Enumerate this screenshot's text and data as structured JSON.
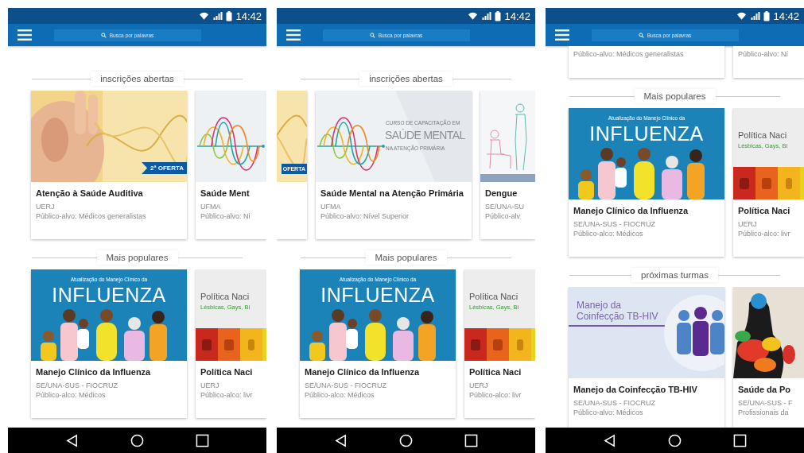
{
  "phones": [
    {
      "status_time": "14:42",
      "search_placeholder": "Busca por palavras",
      "sections": [
        {
          "title": "inscrições abertas",
          "cards": [
            {
              "kind": "full",
              "image": {
                "kind": "ear"
              },
              "badge": "2ª OFERTA",
              "title": "Atenção à Saúde Auditiva",
              "lines": [
                "UERJ",
                "Público-alvo: Médicos generalistas"
              ]
            },
            {
              "kind": "rightcut",
              "image": {
                "kind": "waves"
              },
              "title": "Saúde Ment",
              "lines": [
                "UFMA",
                "Público-alvo: Ni"
              ]
            }
          ]
        },
        {
          "title": "Mais populares",
          "cards": [
            {
              "kind": "full",
              "image": {
                "kind": "influenza",
                "texts": [
                  "Atualização do Manejo Clínico da",
                  "INFLUENZA"
                ]
              },
              "title": "Manejo Clínico da Influenza",
              "lines": [
                "SE/UNA-SUS - FIOCRUZ",
                "Público-alco: Médicos"
              ]
            },
            {
              "kind": "rightcut",
              "image": {
                "kind": "politica",
                "texts": [
                  "Política Naci",
                  "Lésbicas, Gays, Bi"
                ]
              },
              "title": "Política Naci",
              "lines": [
                "UERJ",
                "Público-alco: livr"
              ]
            }
          ]
        }
      ]
    },
    {
      "status_time": "14:42",
      "search_placeholder": "Busca por palavras",
      "sections": [
        {
          "title": "inscrições abertas",
          "cards": [
            {
              "kind": "leftcut",
              "image": {
                "kind": "ear"
              },
              "badge": "OFERTA"
            },
            {
              "kind": "full",
              "image": {
                "kind": "waves",
                "texts": [
                  "CURSO DE CAPACITAÇÃO EM",
                  "SAÚDE MENTAL",
                  "NA ATENÇÃO PRIMÁRIA"
                ]
              },
              "title": "Saúde Mental na Atenção Primária",
              "lines": [
                "UFMA",
                "Público-alvo: Nível Superior"
              ]
            },
            {
              "kind": "rightcut",
              "image": {
                "kind": "dengue"
              },
              "title": "Dengue",
              "lines": [
                "SE/UNA-SU",
                "Público-alv"
              ]
            }
          ]
        },
        {
          "title": "Mais populares",
          "cards": [
            {
              "kind": "full",
              "image": {
                "kind": "influenza",
                "texts": [
                  "Atualização do Manejo Clínico da",
                  "INFLUENZA"
                ]
              },
              "title": "Manejo Clínico da Influenza",
              "lines": [
                "SE/UNA-SUS - FIOCRUZ",
                "Público-alco: Médicos"
              ]
            },
            {
              "kind": "rightcut",
              "image": {
                "kind": "politica",
                "texts": [
                  "Política Naci",
                  "Lésbicas, Gays, Bi"
                ]
              },
              "title": "Política Naci",
              "lines": [
                "UERJ",
                "Público-alco: livr"
              ]
            }
          ]
        }
      ]
    },
    {
      "status_time": "14:42",
      "search_placeholder": "Busca por palavras",
      "sections": [
        {
          "cards": [
            {
              "kind": "topcut",
              "lines": [
                "Público-alvo: Médicos generalistas"
              ]
            },
            {
              "kind": "cornercut",
              "lines": [
                "Público-alvo: Ní"
              ]
            }
          ]
        },
        {
          "title": "Mais populares",
          "cards": [
            {
              "kind": "full",
              "image": {
                "kind": "influenza",
                "texts": [
                  "Atualização do Manejo Clínico da",
                  "INFLUENZA"
                ]
              },
              "title": "Manejo Clínico da Influenza",
              "lines": [
                "SE/UNA-SUS - FIOCRUZ",
                "Público-alco: Médicos"
              ]
            },
            {
              "kind": "rightcut",
              "image": {
                "kind": "politica",
                "texts": [
                  "Política Naci",
                  "Lésbicas, Gays, Bi"
                ]
              },
              "title": "Política Naci",
              "lines": [
                "UERJ",
                "Público-alco: livr"
              ]
            }
          ]
        },
        {
          "title": "próximas turmas",
          "cards": [
            {
              "kind": "full",
              "image": {
                "kind": "tbhiv",
                "texts": [
                  "Manejo da",
                  "Coinfecção TB-HIV"
                ]
              },
              "title": "Manejo da Coinfecção TB-HIV",
              "lines": [
                "SE/UNA-SUS - FIOCRUZ",
                "Público-alvo: Médicos"
              ]
            },
            {
              "kind": "rightcut",
              "image": {
                "kind": "art"
              },
              "title": "Saúde da Po",
              "lines": [
                "SE/UNA-SUS - F",
                "Profissionais da"
              ]
            }
          ]
        }
      ]
    }
  ]
}
